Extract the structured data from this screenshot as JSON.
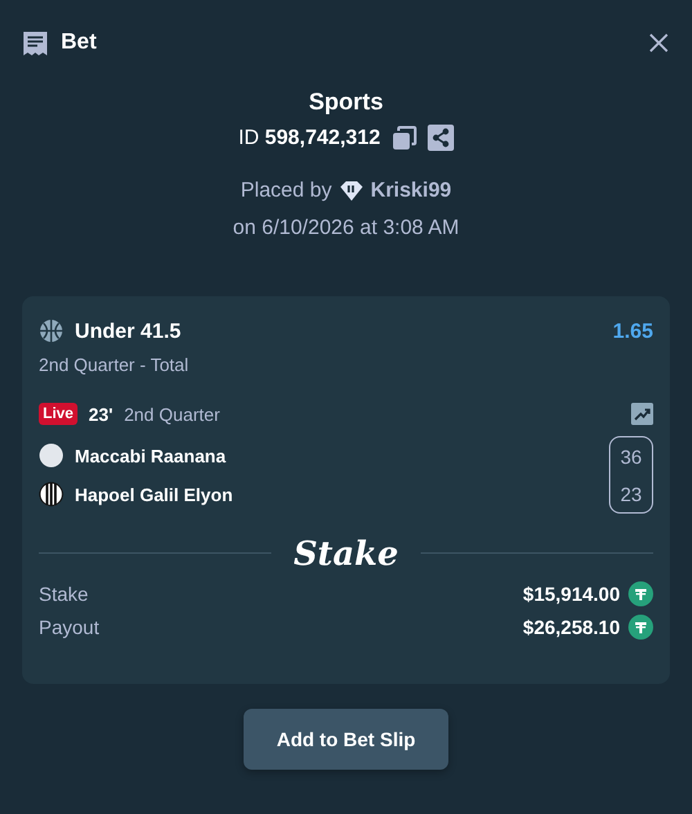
{
  "header": {
    "title": "Bet"
  },
  "summary": {
    "category": "Sports",
    "id_label": "ID",
    "id_value": "598,742,312",
    "placed_by": "Placed by",
    "user": "Kriski99",
    "date": "on 6/10/2026 at 3:08 AM"
  },
  "bet": {
    "selection": "Under 41.5",
    "odds": "1.65",
    "market": "2nd Quarter - Total",
    "live_badge": "Live",
    "clock": "23'",
    "period": "2nd Quarter",
    "teams": [
      {
        "name": "Maccabi Raanana",
        "score": "36",
        "kind": "plain"
      },
      {
        "name": "Hapoel Galil Elyon",
        "score": "23",
        "kind": "striped"
      }
    ],
    "logo": "Stake",
    "amounts": [
      {
        "label": "Stake",
        "value": "$15,914.00"
      },
      {
        "label": "Payout",
        "value": "$26,258.10"
      }
    ]
  },
  "button": "Add to Bet Slip"
}
